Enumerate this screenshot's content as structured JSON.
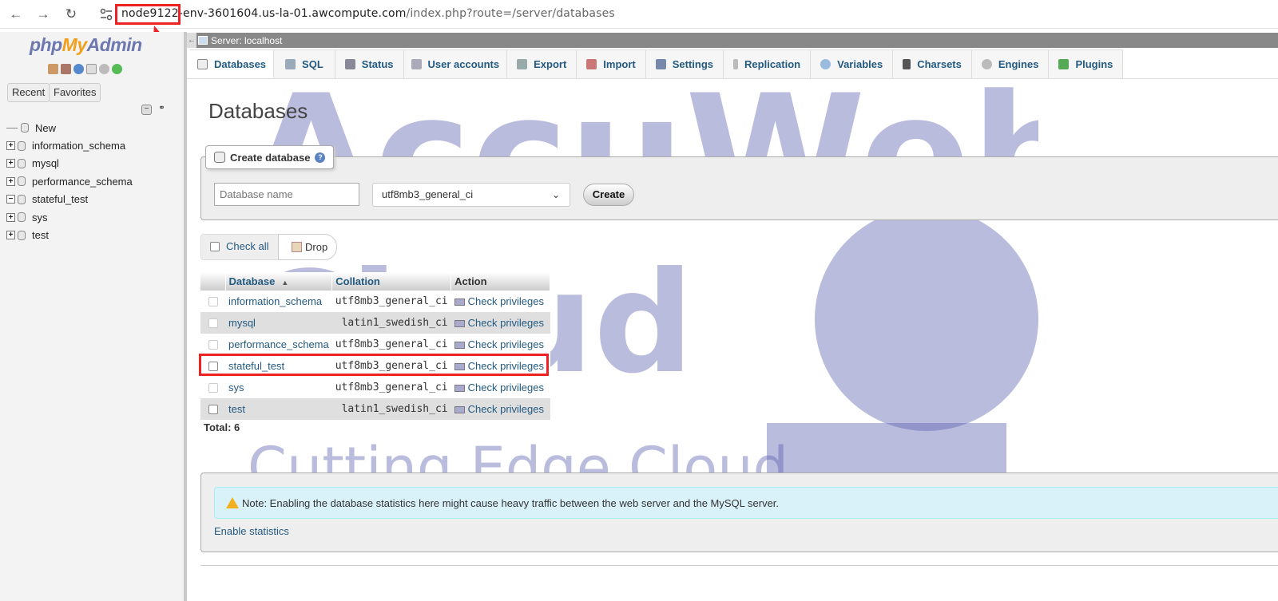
{
  "browser": {
    "url_host_highlight": "node9122",
    "url_host_rest": "-env-3601604.us-la-01.awcompute.com",
    "url_path": "/index.php?route=/server/databases"
  },
  "sidebar": {
    "logo": {
      "php": "php",
      "my": "My",
      "admin": "Admin"
    },
    "recent_label": "Recent",
    "favorites_label": "Favorites",
    "tree": [
      {
        "label": "New"
      },
      {
        "label": "information_schema"
      },
      {
        "label": "mysql"
      },
      {
        "label": "performance_schema"
      },
      {
        "label": "stateful_test"
      },
      {
        "label": "sys"
      },
      {
        "label": "test"
      }
    ]
  },
  "server_bar": {
    "label": "Server: localhost"
  },
  "tabs": [
    {
      "label": "Databases",
      "icon": "database-icon"
    },
    {
      "label": "SQL",
      "icon": "sql-icon"
    },
    {
      "label": "Status",
      "icon": "status-icon"
    },
    {
      "label": "User accounts",
      "icon": "users-icon"
    },
    {
      "label": "Export",
      "icon": "export-icon"
    },
    {
      "label": "Import",
      "icon": "import-icon"
    },
    {
      "label": "Settings",
      "icon": "wrench-icon"
    },
    {
      "label": "Replication",
      "icon": "replication-icon"
    },
    {
      "label": "Variables",
      "icon": "variables-icon"
    },
    {
      "label": "Charsets",
      "icon": "charsets-icon"
    },
    {
      "label": "Engines",
      "icon": "engines-icon"
    },
    {
      "label": "Plugins",
      "icon": "plugin-icon"
    }
  ],
  "main": {
    "title": "Databases",
    "create": {
      "legend": "Create database",
      "placeholder": "Database name",
      "collation": "utf8mb3_general_ci",
      "button": "Create"
    },
    "check_all": "Check all",
    "drop": "Drop",
    "table": {
      "headers": {
        "database": "Database",
        "collation": "Collation",
        "action": "Action"
      },
      "rows": [
        {
          "name": "information_schema",
          "collation": "utf8mb3_general_ci",
          "action": "Check privileges"
        },
        {
          "name": "mysql",
          "collation": "latin1_swedish_ci",
          "action": "Check privileges"
        },
        {
          "name": "performance_schema",
          "collation": "utf8mb3_general_ci",
          "action": "Check privileges"
        },
        {
          "name": "stateful_test",
          "collation": "utf8mb3_general_ci",
          "action": "Check privileges"
        },
        {
          "name": "sys",
          "collation": "utf8mb3_general_ci",
          "action": "Check privileges"
        },
        {
          "name": "test",
          "collation": "latin1_swedish_ci",
          "action": "Check privileges"
        }
      ]
    },
    "total": "Total: 6",
    "notice": "Note: Enabling the database statistics here might cause heavy traffic between the web server and the MySQL server.",
    "enable_statistics": "Enable statistics"
  },
  "watermark": {
    "line1": "AccuWeb",
    "line2": "Cloud",
    "tagline": "Cutting Edge Cloud"
  },
  "colors": {
    "highlight": "#e22222",
    "link": "#235a81",
    "watermark": "#5a5fae"
  }
}
